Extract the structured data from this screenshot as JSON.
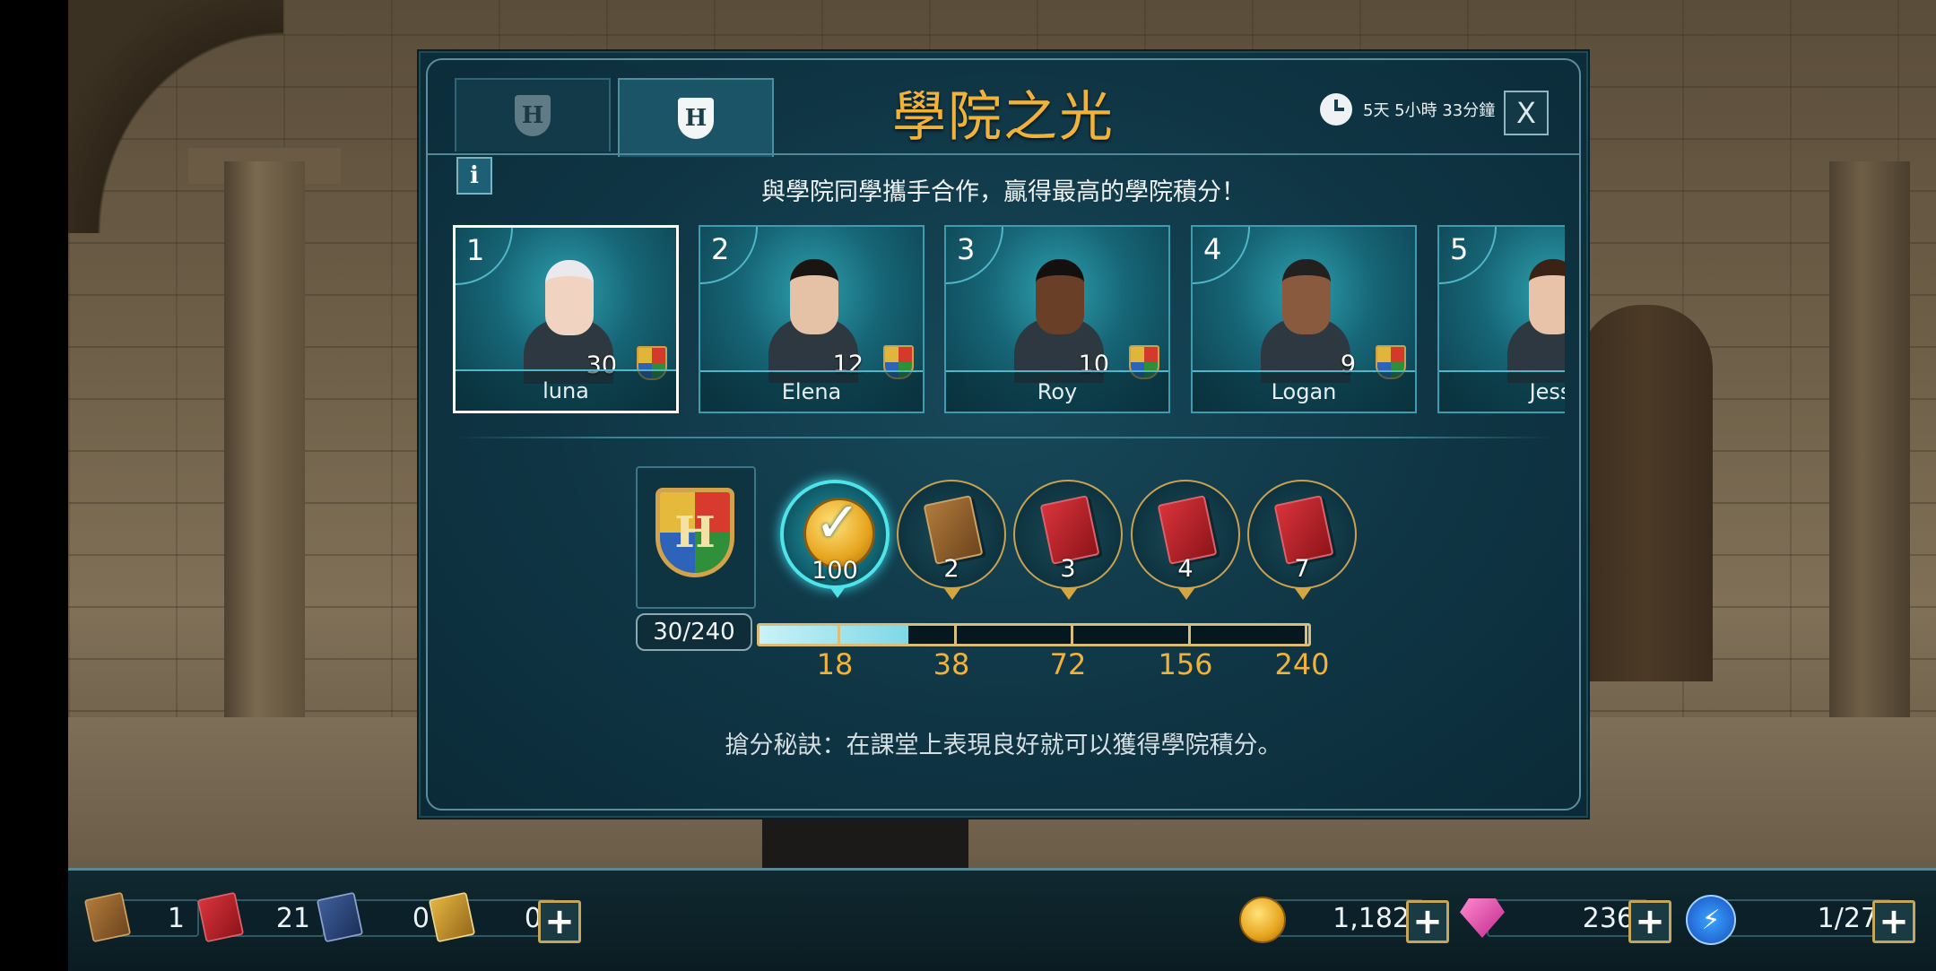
{
  "dialog": {
    "title": "學院之光",
    "timer": "5天 5小時 33分鐘",
    "close_label": "X",
    "info_label": "i",
    "subtitle": "與學院同學攜手合作，贏得最高的學院積分！",
    "tabs": [
      {
        "icon": "house-shield-icon",
        "label": "H",
        "active": false
      },
      {
        "icon": "house-shield-icon",
        "label": "H",
        "active": true
      }
    ],
    "players": [
      {
        "rank": "1",
        "name": "luna",
        "score": "30",
        "selected": true,
        "hair": "#e9e9ee",
        "skin": "#f1d3c2"
      },
      {
        "rank": "2",
        "name": "Elena",
        "score": "12",
        "selected": false,
        "hair": "#1b1512",
        "skin": "#e5c2a5"
      },
      {
        "rank": "3",
        "name": "Roy",
        "score": "10",
        "selected": false,
        "hair": "#141010",
        "skin": "#6a3f27"
      },
      {
        "rank": "4",
        "name": "Logan",
        "score": "9",
        "selected": false,
        "hair": "#232020",
        "skin": "#8a5a3f"
      },
      {
        "rank": "5",
        "name": "Jess",
        "score": "",
        "selected": false,
        "hair": "#3a2214",
        "skin": "#e8c3aa"
      }
    ],
    "progress": {
      "label": "30/240",
      "current": 30,
      "max": 240,
      "house_crest": "H"
    },
    "rewards": [
      {
        "icon": "coin-check-icon",
        "qty": "100",
        "threshold": "18",
        "claimed": true
      },
      {
        "icon": "brown-book-icon",
        "qty": "2",
        "threshold": "38",
        "claimed": false
      },
      {
        "icon": "red-book-icon",
        "qty": "3",
        "threshold": "72",
        "claimed": false
      },
      {
        "icon": "red-book-icon",
        "qty": "4",
        "threshold": "156",
        "claimed": false
      },
      {
        "icon": "red-book-icon",
        "qty": "7",
        "threshold": "240",
        "claimed": false
      }
    ],
    "tip": "搶分秘訣：在課堂上表現良好就可以獲得學院積分。"
  },
  "hud": {
    "brown_books": "1",
    "red_books": "21",
    "blue_books": "0",
    "gold_books": "0",
    "coins": "1,182",
    "gems": "236",
    "energy": "1/27",
    "plus_label": "+",
    "energy_symbol": "⚡"
  },
  "colors": {
    "title_gold": "#f0b23a",
    "panel_teal": "#0f3544",
    "accent_cyan": "#4fe3ea"
  }
}
